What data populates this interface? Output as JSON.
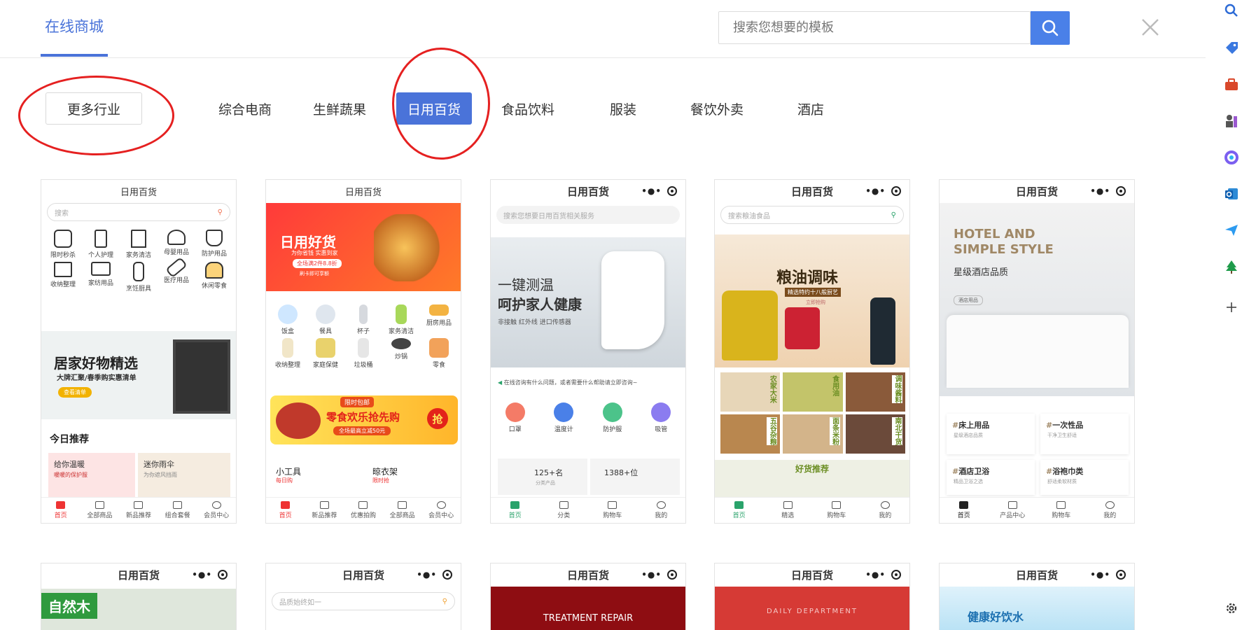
{
  "header": {
    "active_tab": "在线商城",
    "search_placeholder": "搜索您想要的模板"
  },
  "categories": {
    "more": "更多行业",
    "items": [
      "综合电商",
      "生鲜蔬果",
      "日用百货",
      "食品饮料",
      "服装",
      "餐饮外卖",
      "酒店"
    ],
    "active_index": 2
  },
  "colors": {
    "accent": "#4a73d9",
    "search_button": "#4a80e8",
    "annotation_ring": "#e52020"
  },
  "cards_row1": [
    {
      "title": "日用百货",
      "search": "搜索",
      "icons": [
        "限时秒杀",
        "个人护理",
        "家务清洁",
        "母婴用品",
        "防护用品",
        "收纳整理",
        "家纺用品",
        "烹饪厨具",
        "医疗用品",
        "休闲零食"
      ],
      "banner_title": "居家好物精选",
      "banner_sub": "大牌汇聚/春季购实惠清单",
      "banner_btn": "查看清单",
      "section": "今日推荐",
      "promo1": "给你温暖",
      "promo1_sub": "暖暖的保护服",
      "promo2": "迷你雨伞",
      "promo2_sub": "为你遮风挡雨",
      "nav": [
        "首页",
        "全部商品",
        "新品推荐",
        "组合套餐",
        "会员中心"
      ]
    },
    {
      "title": "日用百货",
      "banner_title": "日用好货",
      "banner_sub1": "为你省钱 实惠到家",
      "banner_sub2": "全场满2件8.8折",
      "banner_sub3": "刷卡即可享额",
      "icons": [
        "饭盒",
        "餐具",
        "杯子",
        "家务清洁",
        "厨房用品",
        "收纳整理",
        "家庭保健",
        "垃圾桶",
        "炒锅",
        "零食"
      ],
      "promo_tag": "限时包邮",
      "promo_title": "零食欢乐抢先购",
      "promo_sub": "全场最高立减50元",
      "promo_badge": "抢",
      "item1": "小工具",
      "item1_tag": "每日购",
      "item2": "晾衣架",
      "item2_tag": "限时抢",
      "nav": [
        "首页",
        "新品推荐",
        "优惠拍购",
        "全部商品",
        "会员中心"
      ]
    },
    {
      "title": "日用百货",
      "search": "搜索您想要日用百货相关服务",
      "banner_l1": "一键测温",
      "banner_l2": "呵护家人健康",
      "banner_l3": "非接触  红外线  进口传感器",
      "notice": "在线咨询有什么问题，或者需要什么帮助请立即咨询~",
      "icons": [
        "口罩",
        "温度计",
        "防护服",
        "吸管"
      ],
      "stat1": "125+名",
      "stat1_sub": "分类产品",
      "stat2": "1388+位",
      "nav": [
        "首页",
        "分类",
        "购物车",
        "我的"
      ]
    },
    {
      "title": "日用百货",
      "search": "搜索粮油食品",
      "banner_title": "粮油调味",
      "banner_sub": "精选特约十八般厨艺",
      "banner_btn": "立即抢购",
      "tiles": [
        "农家大米",
        "食用油",
        "调味酱料",
        "五谷杂粮",
        "面条米粉",
        "南北干货"
      ],
      "section": "好货推荐",
      "nav": [
        "首页",
        "精选",
        "购物车",
        "我的"
      ]
    },
    {
      "title": "日用百货",
      "banner_l1": "HOTEL AND",
      "banner_l2": "SIMPLE STYLE",
      "banner_cn": "星级酒店品质",
      "banner_btn": "酒店用品",
      "tiles": [
        {
          "name": "床上用品",
          "sub": "星级酒店品质"
        },
        {
          "name": "一次性品",
          "sub": "干净卫生舒适"
        },
        {
          "name": "酒店卫浴",
          "sub": "精品卫浴之选"
        },
        {
          "name": "浴袍巾类",
          "sub": "舒适柔软材质"
        }
      ],
      "nav": [
        "首页",
        "产品中心",
        "购物车",
        "我的"
      ]
    }
  ],
  "cards_row2": [
    {
      "title": "日用百货",
      "banner": "自然木"
    },
    {
      "title": "日用百货",
      "search": "品质始终如一"
    },
    {
      "title": "日用百货",
      "banner": "TREATMENT REPAIR"
    },
    {
      "title": "日用百货",
      "banner": "DAILY DEPARTMENT"
    },
    {
      "title": "日用百货",
      "banner": "健康好饮水"
    }
  ]
}
